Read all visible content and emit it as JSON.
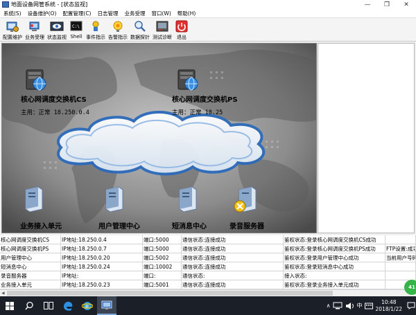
{
  "window": {
    "title": "地面设备网管系统 - [状态监视]",
    "minimize_glyph": "—",
    "restore_glyph": "❐",
    "close_glyph": "✕"
  },
  "menu": [
    {
      "label": "系统(S)"
    },
    {
      "label": "设备维护(O)"
    },
    {
      "label": "配置管理(C)"
    },
    {
      "label": "日志管理"
    },
    {
      "label": "业务受理"
    },
    {
      "label": "窗口(W)"
    },
    {
      "label": "帮助(H)"
    }
  ],
  "toolbar": [
    {
      "label": "配置维护",
      "icon": "config-maintenance-icon"
    },
    {
      "label": "业务受理",
      "icon": "business-acceptance-icon"
    },
    {
      "label": "状态监视",
      "icon": "status-monitor-icon"
    },
    {
      "label": "Shell",
      "icon": "shell-icon"
    },
    {
      "label": "事件指示",
      "icon": "event-indicator-icon"
    },
    {
      "label": "告警指示",
      "icon": "alarm-indicator-icon"
    },
    {
      "label": "数据探针",
      "icon": "data-probe-icon"
    },
    {
      "label": "测试诊断",
      "icon": "test-diagnosis-icon"
    },
    {
      "label": "退出",
      "icon": "power-icon"
    }
  ],
  "topology": {
    "nodes": [
      {
        "label": "核心网调度交换机CS",
        "status_prefix": "主用：",
        "status_value": "正常 18.250.0.4",
        "icon": "globe-server-icon"
      },
      {
        "label": "核心网调度交换机PS",
        "status_prefix": "主用：",
        "status_value": "正常 18.25",
        "icon": "globe-server-icon"
      },
      {
        "label": "业务接入单元",
        "icon": "server-icon"
      },
      {
        "label": "用户管理中心",
        "icon": "server-icon"
      },
      {
        "label": "短消息中心",
        "icon": "server-icon"
      },
      {
        "label": "录音服务器",
        "icon": "server-fault-icon"
      }
    ]
  },
  "status_rows": [
    [
      "核心网调度交换机CS",
      "IP地址:18.250.0.4",
      "端口:5000",
      "通信状态:连接成功",
      "鉴权状态:登录核心网调度交换机CS成功",
      ""
    ],
    [
      "核心网调度交换机PS",
      "IP地址:18.250.0.7",
      "端口:5000",
      "通信状态:连接成功",
      "鉴权状态:登录核心网调度交换机PS成功",
      "FTP设置:成功"
    ],
    [
      "用户管理中心",
      "IP地址:18.250.0.20",
      "端口:5002",
      "通信状态:连接成功",
      "鉴权状态:登录用户管理中心成功",
      "当前用户号码"
    ],
    [
      "短消息中心",
      "IP地址:18.250.0.24",
      "端口:10002",
      "通信状态:连接成功",
      "鉴权状态:登录短消息中心成功",
      ""
    ],
    [
      "录音服务器",
      "IP地址:",
      "端口:",
      "通信状态:",
      "接入状态:",
      ""
    ],
    [
      "业务接入单元",
      "IP地址:18.250.0.23",
      "端口:5001",
      "通信状态:连接成功",
      "鉴权状态:登录业务接入单元成功",
      ""
    ]
  ],
  "badge": "41",
  "tray": {
    "lang": "中",
    "time": "10:48",
    "date": "2018/1/22"
  }
}
